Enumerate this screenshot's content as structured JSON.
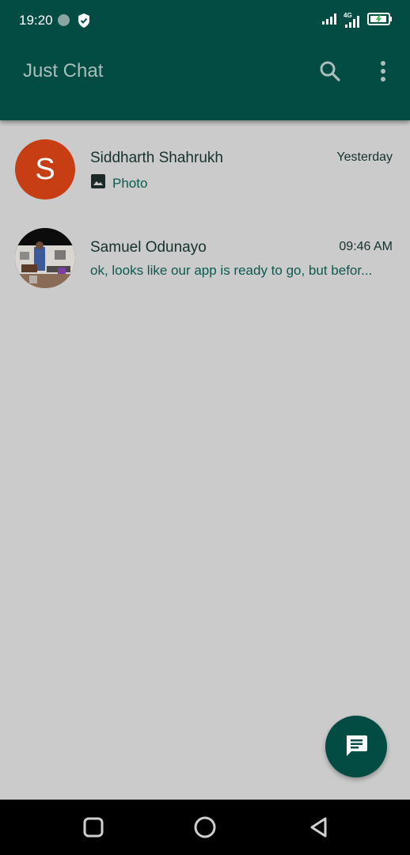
{
  "status_bar": {
    "time": "19:20",
    "network": "4G",
    "icons": [
      "notification-dot-icon",
      "shield-icon",
      "signal-icon",
      "signal-4g-icon",
      "battery-charging-icon"
    ]
  },
  "app_bar": {
    "title": "Just Chat",
    "icons": [
      "search-icon",
      "more-vert-icon"
    ],
    "color": "#034c44"
  },
  "chats": [
    {
      "name": "Siddharth Shahrukh",
      "avatar_letter": "S",
      "avatar_color": "#c73d14",
      "preview": "Photo",
      "preview_icon": "image-icon",
      "time": "Yesterday"
    },
    {
      "name": "Samuel Odunayo",
      "avatar_image": "photo",
      "preview": "ok, looks like our app is ready to go, but befor...",
      "time": "09:46 AM"
    }
  ],
  "fab": {
    "icon": "message-icon"
  },
  "nav_bar": {
    "icons": [
      "recents-square-icon",
      "home-circle-icon",
      "back-triangle-icon"
    ]
  }
}
